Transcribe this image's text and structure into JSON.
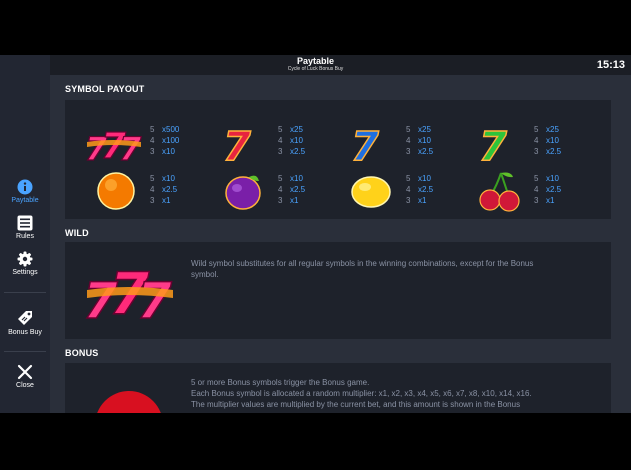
{
  "header": {
    "title": "Paytable",
    "subtitle": "Cycle of Luck Bonus Buy",
    "clock": "15:13"
  },
  "sidebar": {
    "items": [
      {
        "label": "Paytable",
        "icon": "info-icon",
        "active": true
      },
      {
        "label": "Rules",
        "icon": "list-icon"
      },
      {
        "label": "Settings",
        "icon": "gear-icon"
      },
      {
        "label": "Bonus Buy",
        "icon": "bonus-tag-icon"
      },
      {
        "label": "Close",
        "icon": "close-icon"
      }
    ]
  },
  "symbol_payout": {
    "title": "SYMBOL PAYOUT",
    "symbols": [
      {
        "name": "triple-seven-symbol",
        "pays": [
          {
            "n": "5",
            "m": "x500"
          },
          {
            "n": "4",
            "m": "x100"
          },
          {
            "n": "3",
            "m": "x10"
          }
        ]
      },
      {
        "name": "red-seven-symbol",
        "pays": [
          {
            "n": "5",
            "m": "x25"
          },
          {
            "n": "4",
            "m": "x10"
          },
          {
            "n": "3",
            "m": "x2.5"
          }
        ]
      },
      {
        "name": "blue-seven-symbol",
        "pays": [
          {
            "n": "5",
            "m": "x25"
          },
          {
            "n": "4",
            "m": "x10"
          },
          {
            "n": "3",
            "m": "x2.5"
          }
        ]
      },
      {
        "name": "green-seven-symbol",
        "pays": [
          {
            "n": "5",
            "m": "x25"
          },
          {
            "n": "4",
            "m": "x10"
          },
          {
            "n": "3",
            "m": "x2.5"
          }
        ]
      },
      {
        "name": "orange-symbol",
        "pays": [
          {
            "n": "5",
            "m": "x10"
          },
          {
            "n": "4",
            "m": "x2.5"
          },
          {
            "n": "3",
            "m": "x1"
          }
        ]
      },
      {
        "name": "plum-symbol",
        "pays": [
          {
            "n": "5",
            "m": "x10"
          },
          {
            "n": "4",
            "m": "x2.5"
          },
          {
            "n": "3",
            "m": "x1"
          }
        ]
      },
      {
        "name": "lemon-symbol",
        "pays": [
          {
            "n": "5",
            "m": "x10"
          },
          {
            "n": "4",
            "m": "x2.5"
          },
          {
            "n": "3",
            "m": "x1"
          }
        ]
      },
      {
        "name": "cherry-symbol",
        "pays": [
          {
            "n": "5",
            "m": "x10"
          },
          {
            "n": "4",
            "m": "x2.5"
          },
          {
            "n": "3",
            "m": "x1"
          }
        ]
      }
    ]
  },
  "wild": {
    "title": "WILD",
    "text_line1": "Wild symbol substitutes for all regular symbols in the winning combinations, except for the Bonus",
    "text_line2": "symbol."
  },
  "bonus": {
    "title": "BONUS",
    "line1": "5 or more Bonus symbols trigger the Bonus game.",
    "line2": "Each Bonus symbol is allocated a random multiplier: x1, x2, x3, x4, x5, x6, x7, x8, x10, x14, x16.",
    "line3": "The multiplier values are multiplied by the current bet, and this amount is shown in the Bonus"
  },
  "colors": {
    "accent": "#4aa3ff",
    "panel": "#1e222b",
    "background": "#2a2f3a",
    "muted_text": "#8a92a4"
  }
}
